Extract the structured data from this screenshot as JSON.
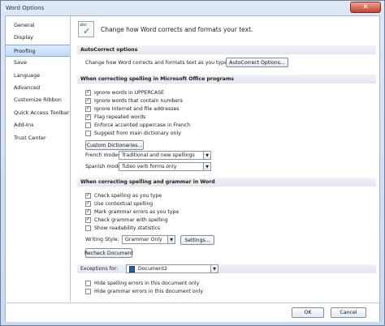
{
  "window": {
    "title": "Word Options",
    "close_glyph": "✕"
  },
  "sidebar": {
    "items": [
      {
        "label": "General"
      },
      {
        "label": "Display"
      },
      {
        "label": "Proofing",
        "selected": true
      },
      {
        "label": "Save"
      },
      {
        "label": "Language"
      },
      {
        "label": "Advanced"
      },
      {
        "label": "Customize Ribbon"
      },
      {
        "label": "Quick Access Toolbar"
      },
      {
        "label": "Add-Ins"
      },
      {
        "label": "Trust Center"
      }
    ]
  },
  "header": {
    "icon": "abc-check-icon",
    "icon_text": "abc",
    "text": "Change how Word corrects and formats your text."
  },
  "autocorrect": {
    "title": "AutoCorrect options",
    "label": "Change how Word corrects and formats text as you type:",
    "button": "AutoCorrect Options..."
  },
  "office_spelling": {
    "title": "When correcting spelling in Microsoft Office programs",
    "items": [
      {
        "label": "Ignore words in UPPERCASE",
        "checked": true
      },
      {
        "label": "Ignore words that contain numbers",
        "checked": true
      },
      {
        "label": "Ignore Internet and file addresses",
        "checked": true
      },
      {
        "label": "Flag repeated words",
        "checked": true
      },
      {
        "label": "Enforce accented uppercase in French",
        "checked": false
      },
      {
        "label": "Suggest from main dictionary only",
        "checked": false
      }
    ],
    "custom_dict_button": "Custom Dictionaries...",
    "french_modes_label": "French modes:",
    "french_modes_value": "Traditional and new spellings",
    "spanish_modes_label": "Spanish modes:",
    "spanish_modes_value": "Tuteo verb forms only"
  },
  "word_spelling": {
    "title": "When correcting spelling and grammar in Word",
    "items": [
      {
        "label": "Check spelling as you type",
        "checked": true
      },
      {
        "label": "Use contextual spelling",
        "checked": true
      },
      {
        "label": "Mark grammar errors as you type",
        "checked": true
      },
      {
        "label": "Check grammar with spelling",
        "checked": true
      },
      {
        "label": "Show readability statistics",
        "checked": false
      }
    ],
    "writing_style_label": "Writing Style:",
    "writing_style_value": "Grammar Only",
    "settings_button": "Settings...",
    "recheck_button": "Recheck Document"
  },
  "exceptions": {
    "label": "Exceptions for:",
    "document": "Document2",
    "items": [
      {
        "label": "Hide spelling errors in this document only",
        "checked": false
      },
      {
        "label": "Hide grammar errors in this document only",
        "checked": false
      }
    ]
  },
  "footer": {
    "ok": "OK",
    "cancel": "Cancel"
  },
  "glyphs": {
    "check": "✓",
    "dropdown": "▼"
  }
}
